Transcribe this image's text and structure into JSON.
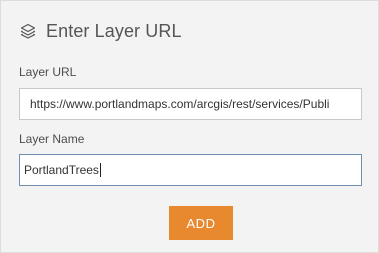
{
  "dialog": {
    "title": "Enter Layer URL",
    "icon": "layers-icon"
  },
  "form": {
    "url_label": "Layer URL",
    "url_value": "https://www.portlandmaps.com/arcgis/rest/services/Publi",
    "name_label": "Layer Name",
    "name_value": "PortlandTrees",
    "add_label": "ADD"
  },
  "colors": {
    "panel_bg": "#f3f3f3",
    "button_bg": "#e8892f",
    "button_text": "#ffffff",
    "focus_border": "#6f8fb3"
  }
}
